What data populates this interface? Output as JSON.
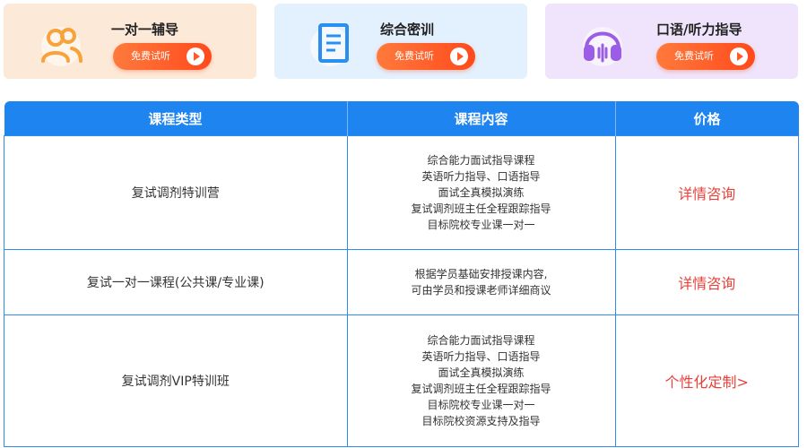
{
  "cards": [
    {
      "title": "一对一辅导",
      "button": "免费试听",
      "icon": "users-icon",
      "color": "#f7a23b"
    },
    {
      "title": "综合密训",
      "button": "免费试听",
      "icon": "book-icon",
      "color": "#2b8ff2"
    },
    {
      "title": "口语/听力指导",
      "button": "免费试听",
      "icon": "headphones-icon",
      "color": "#9b5de5"
    }
  ],
  "table": {
    "headers": [
      "课程类型",
      "课程内容",
      "价格"
    ],
    "rows": [
      {
        "type": "复试调剂特训营",
        "content": [
          "综合能力面试指导课程",
          "英语听力指导、口语指导",
          "面试全真模拟演练",
          "复试调剂班主任全程跟踪指导",
          "目标院校专业课一对一"
        ],
        "price": "详情咨询"
      },
      {
        "type": "复试一对一课程(公共课/专业课)",
        "content": [
          "根据学员基础安排授课内容,",
          "可由学员和授课老师详细商议"
        ],
        "price": "详情咨询"
      },
      {
        "type": "复试调剂VIP特训班",
        "content": [
          "综合能力面试指导课程",
          "英语听力指导、口语指导",
          "面试全真模拟演练",
          "复试调剂班主任全程跟踪指导",
          "目标院校专业课一对一",
          "目标院校资源支持及指导"
        ],
        "price": "个性化定制>"
      }
    ]
  },
  "colors": {
    "header": "#1e84f0",
    "price": "#e8413a",
    "button": "#ff5a2a"
  }
}
